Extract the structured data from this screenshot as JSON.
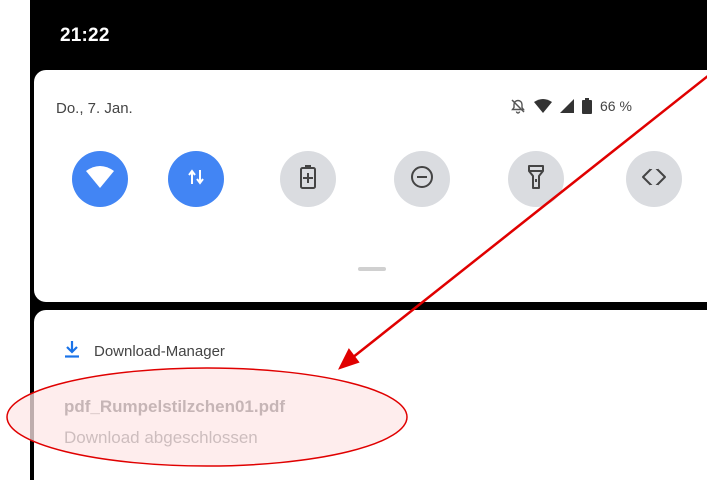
{
  "status_bar": {
    "time": "21:22"
  },
  "quick_settings": {
    "date": "Do., 7. Jan.",
    "battery_percent": "66 %",
    "tiles": [
      {
        "icon": "wifi-icon",
        "state": "on"
      },
      {
        "icon": "mobile-data-icon",
        "state": "on"
      },
      {
        "icon": "battery-saver-icon",
        "state": "off"
      },
      {
        "icon": "do-not-disturb-icon",
        "state": "off"
      },
      {
        "icon": "flashlight-icon",
        "state": "off"
      },
      {
        "icon": "auto-rotate-icon",
        "state": "off"
      }
    ]
  },
  "notification": {
    "app_name": "Download-Manager",
    "title": "pdf_Rumpelstilzchen01.pdf",
    "text": "Download abgeschlossen"
  },
  "colors": {
    "accent": "#4285f4",
    "annotation_red": "#e00000",
    "annotation_fill": "#fde7e7"
  }
}
